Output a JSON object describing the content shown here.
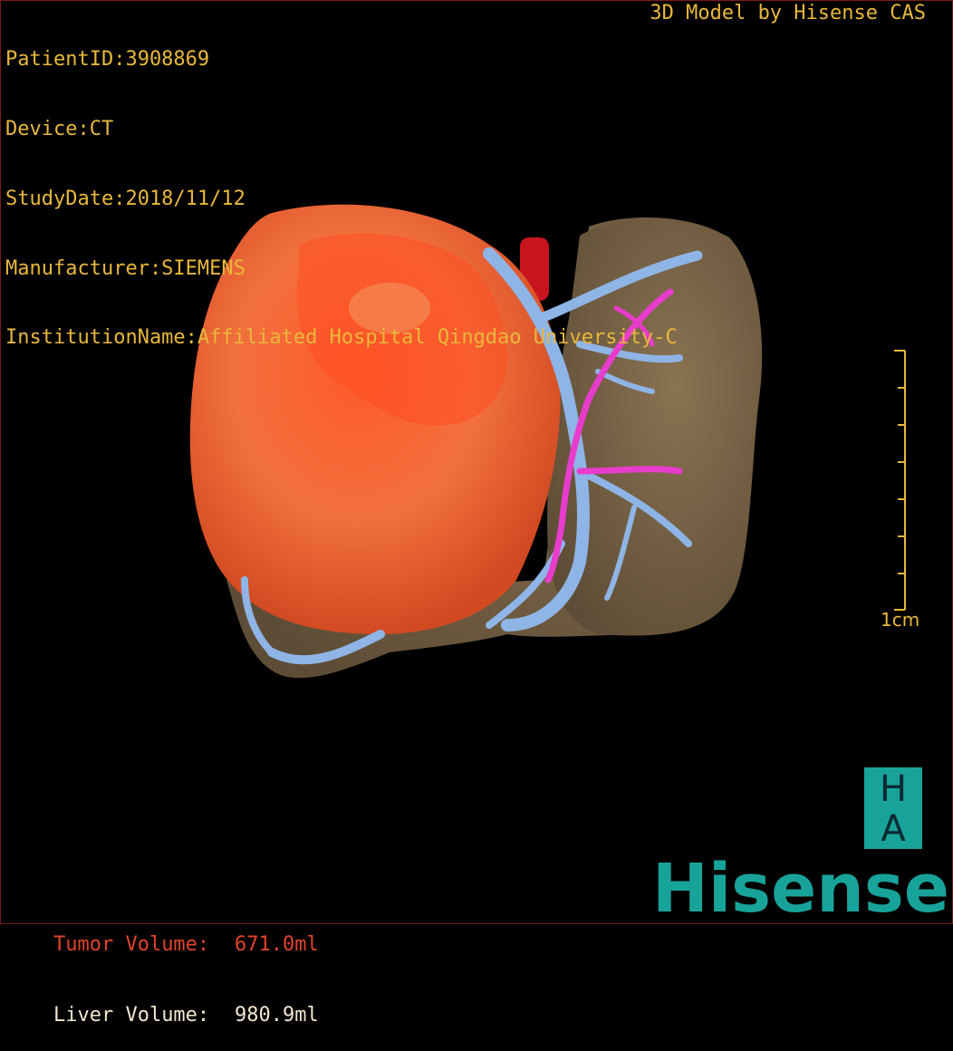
{
  "header": {
    "patient_id": "PatientID:3908869",
    "device": "Device:CT",
    "study_date": "StudyDate:2018/11/12",
    "manufacturer": "Manufacturer:SIEMENS",
    "institution": "InstitutionName:Affiliated Hospital Qingdao University-C",
    "credit": "3D Model by Hisense CAS"
  },
  "volumes": {
    "tumor_label": "Tumor Volume:",
    "tumor_value": "671.0ml",
    "liver_label": "Liver Volume:",
    "liver_value": "980.9ml"
  },
  "scale": {
    "label": "1cm"
  },
  "logo": {
    "letter_top": "H",
    "letter_bottom": "A",
    "brand": "Hisense"
  },
  "colors": {
    "overlay_text": "#e8b83a",
    "tumor_label": "#e0442a",
    "liver": "#7a6547",
    "tumor": "#f06a3a",
    "portal_vein": "#8fb4e6",
    "hepatic_artery": "#e83ccc",
    "aorta": "#c8141e",
    "brand": "#18a39a"
  }
}
